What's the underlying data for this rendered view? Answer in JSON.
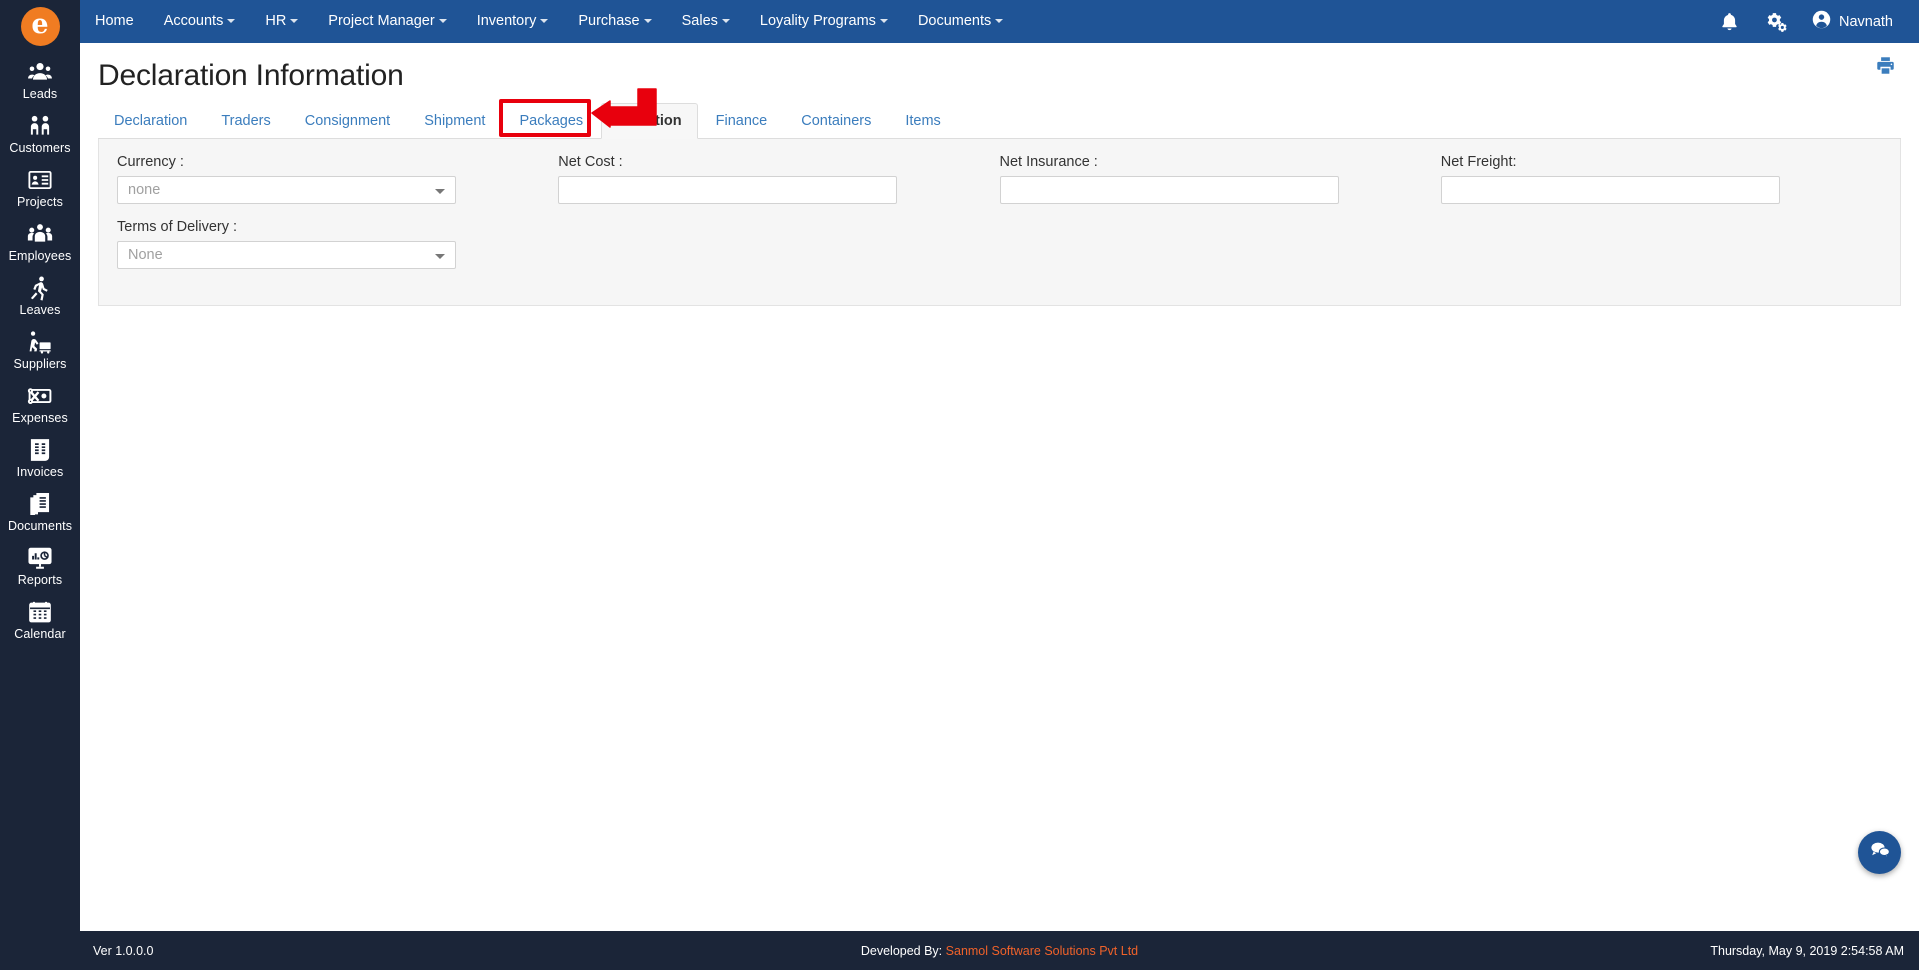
{
  "brand": {
    "logo_letter": "e",
    "logo_color": "#f07c22",
    "nav_bg": "#1f5496",
    "sidebar_bg": "#1b2538",
    "accent": "#f0622a",
    "annotation_color": "#e8000d"
  },
  "sidebar": {
    "items": [
      {
        "label": "Leads",
        "icon": "leads-icon"
      },
      {
        "label": "Customers",
        "icon": "customers-icon"
      },
      {
        "label": "Projects",
        "icon": "projects-icon"
      },
      {
        "label": "Employees",
        "icon": "employees-icon"
      },
      {
        "label": "Leaves",
        "icon": "leaves-icon"
      },
      {
        "label": "Suppliers",
        "icon": "suppliers-icon"
      },
      {
        "label": "Expenses",
        "icon": "expenses-icon"
      },
      {
        "label": "Invoices",
        "icon": "invoices-icon"
      },
      {
        "label": "Documents",
        "icon": "documents-icon"
      },
      {
        "label": "Reports",
        "icon": "reports-icon"
      },
      {
        "label": "Calendar",
        "icon": "calendar-icon"
      }
    ]
  },
  "topnav": {
    "items": [
      {
        "label": "Home",
        "has_caret": false
      },
      {
        "label": "Accounts",
        "has_caret": true
      },
      {
        "label": "HR",
        "has_caret": true
      },
      {
        "label": "Project Manager",
        "has_caret": true
      },
      {
        "label": "Inventory",
        "has_caret": true
      },
      {
        "label": "Purchase",
        "has_caret": true
      },
      {
        "label": "Sales",
        "has_caret": true
      },
      {
        "label": "Loyality Programs",
        "has_caret": true
      },
      {
        "label": "Documents",
        "has_caret": true
      }
    ],
    "notifications_icon": "bell-icon",
    "settings_icon": "gears-icon",
    "user": "Navnath",
    "user_icon": "user-avatar-icon"
  },
  "main": {
    "title": "Declaration Information",
    "print_icon": "print-icon",
    "tabs": [
      {
        "label": "Declaration",
        "active": false
      },
      {
        "label": "Traders",
        "active": false
      },
      {
        "label": "Consignment",
        "active": false
      },
      {
        "label": "Shipment",
        "active": false
      },
      {
        "label": "Packages",
        "active": false
      },
      {
        "label": "Valuation",
        "active": true
      },
      {
        "label": "Finance",
        "active": false
      },
      {
        "label": "Containers",
        "active": false
      },
      {
        "label": "Items",
        "active": false
      }
    ],
    "form": {
      "currency": {
        "label": "Currency :",
        "value": "none",
        "control": "select"
      },
      "net_cost": {
        "label": "Net Cost :",
        "value": "",
        "placeholder": "",
        "control": "text"
      },
      "net_insurance": {
        "label": "Net Insurance :",
        "value": "",
        "placeholder": "",
        "control": "text"
      },
      "net_freight": {
        "label": "Net Freight:",
        "value": "",
        "placeholder": "",
        "control": "text"
      },
      "terms_of_delivery": {
        "label": "Terms of Delivery :",
        "value": "None",
        "control": "select"
      }
    },
    "chat_icon": "chat-bubble-icon"
  },
  "footer": {
    "version": "Ver 1.0.0.0",
    "developed_by_prefix": "Developed By:",
    "developed_by": "Sanmol Software Solutions Pvt Ltd",
    "datetime": "Thursday, May 9, 2019 2:54:58 AM"
  }
}
